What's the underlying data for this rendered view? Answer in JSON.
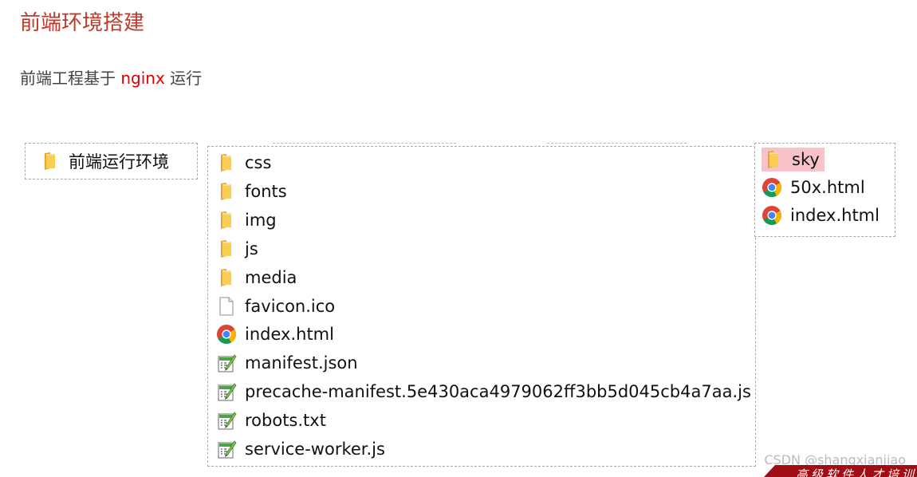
{
  "heading": "前端环境搭建",
  "intro": {
    "before": "前端工程基于 ",
    "highlight": "nginx",
    "after": " 运行"
  },
  "root_folder": {
    "name": "前端运行环境",
    "icon": "folder-icon"
  },
  "dist_files": [
    {
      "name": "css",
      "icon": "folder-icon"
    },
    {
      "name": "fonts",
      "icon": "folder-icon"
    },
    {
      "name": "img",
      "icon": "folder-icon"
    },
    {
      "name": "js",
      "icon": "folder-icon"
    },
    {
      "name": "media",
      "icon": "folder-icon"
    },
    {
      "name": "favicon.ico",
      "icon": "blank-file-icon"
    },
    {
      "name": "index.html",
      "icon": "chrome-icon"
    },
    {
      "name": "manifest.json",
      "icon": "script-file-icon"
    },
    {
      "name": "precache-manifest.5e430aca4979062ff3bb5d045cb4a7aa.js",
      "icon": "script-file-icon"
    },
    {
      "name": "robots.txt",
      "icon": "script-file-icon"
    },
    {
      "name": "service-worker.js",
      "icon": "script-file-icon"
    }
  ],
  "html_files": [
    {
      "name": "sky",
      "icon": "folder-icon",
      "selected": true
    },
    {
      "name": "50x.html",
      "icon": "chrome-icon"
    },
    {
      "name": "index.html",
      "icon": "chrome-icon"
    }
  ],
  "watermark": "CSDN @shangxianjiao",
  "ribbon_text": "高级软件人才培训",
  "colors": {
    "heading": "#c0392b",
    "highlight": "#e00000",
    "selection": "#f7c3c8",
    "ribbon": "#a10d14"
  }
}
